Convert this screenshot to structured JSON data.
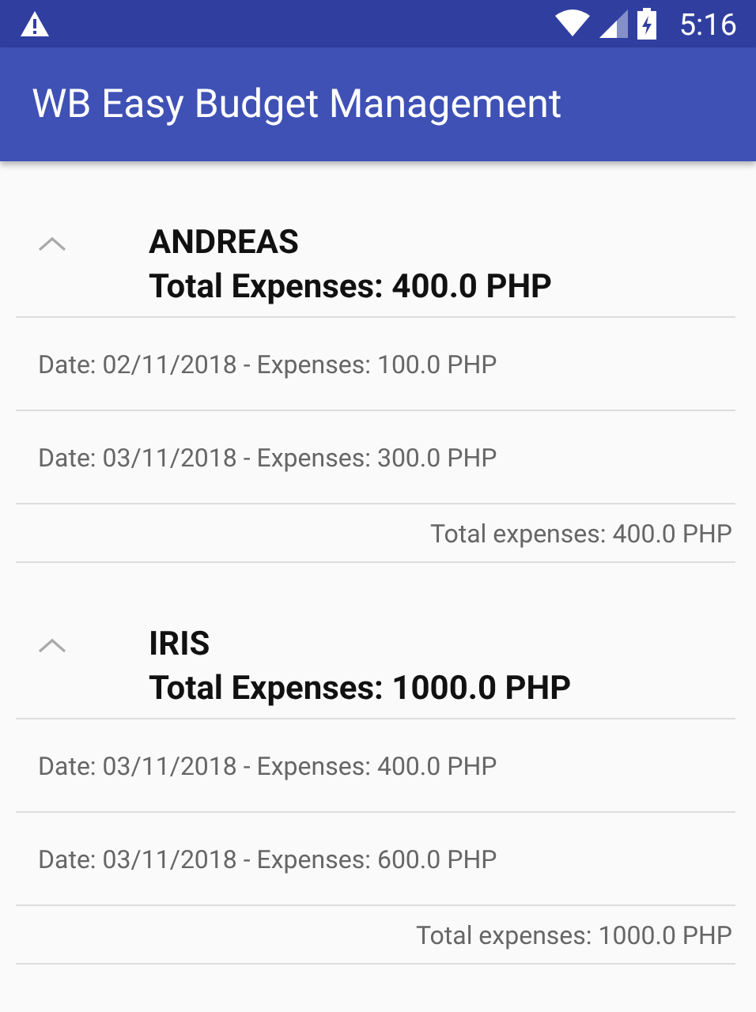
{
  "status_bar": {
    "time": "5:16"
  },
  "app_bar": {
    "title": "WB Easy Budget Management"
  },
  "groups": [
    {
      "name": "ANDREAS",
      "total": "Total Expenses: 400.0 PHP",
      "expanded": true,
      "entries": [
        "Date: 02/11/2018 - Expenses: 100.0 PHP",
        "Date: 03/11/2018 - Expenses: 300.0 PHP"
      ],
      "footer": "Total expenses: 400.0 PHP"
    },
    {
      "name": "IRIS",
      "total": "Total Expenses: 1000.0 PHP",
      "expanded": true,
      "entries": [
        "Date: 03/11/2018 - Expenses: 400.0 PHP",
        "Date: 03/11/2018 - Expenses: 600.0 PHP"
      ],
      "footer": "Total expenses: 1000.0 PHP"
    }
  ]
}
